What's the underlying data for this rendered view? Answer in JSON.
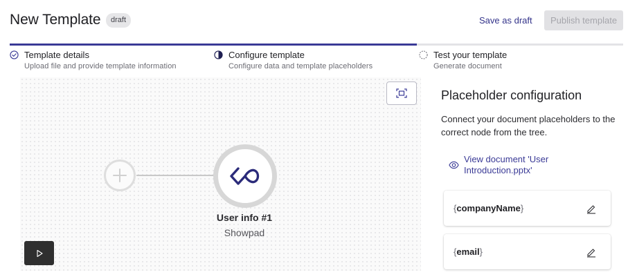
{
  "header": {
    "title": "New Template",
    "badge": "draft",
    "save_draft_label": "Save as draft",
    "publish_label": "Publish template"
  },
  "progress": {
    "fill_fraction": 0.664
  },
  "steps": [
    {
      "label": "Template details",
      "sublabel": "Upload file and provide template information",
      "icon": "check-circle-icon",
      "state": "complete"
    },
    {
      "label": "Configure template",
      "sublabel": "Configure data and template placeholders",
      "icon": "half-circle-icon",
      "state": "current"
    },
    {
      "label": "Test your template",
      "sublabel": "Generate document",
      "icon": "dashed-circle-icon",
      "state": "upcoming"
    }
  ],
  "canvas": {
    "node_title": "User info #1",
    "node_subtitle": "Showpad",
    "node_icon": "infinity-logo-icon",
    "add_icon": "plus-icon",
    "fit_icon": "fit-to-screen-icon",
    "play_icon": "play-icon"
  },
  "panel": {
    "title": "Placeholder configuration",
    "description": "Connect your document placeholders to the correct node from the tree.",
    "view_doc_label": "View document 'User Introduction.pptx'",
    "view_doc_icon": "eye-icon",
    "placeholders": [
      {
        "name": "companyName",
        "open": "{",
        "close": "}"
      },
      {
        "name": "email",
        "open": "{",
        "close": "}"
      }
    ],
    "edit_icon": "pencil-icon"
  },
  "colors": {
    "accent": "#3a3a96",
    "link": "#33338a",
    "disabled_bg": "#e1e1e4",
    "node_ring": "#d7d7d7"
  }
}
